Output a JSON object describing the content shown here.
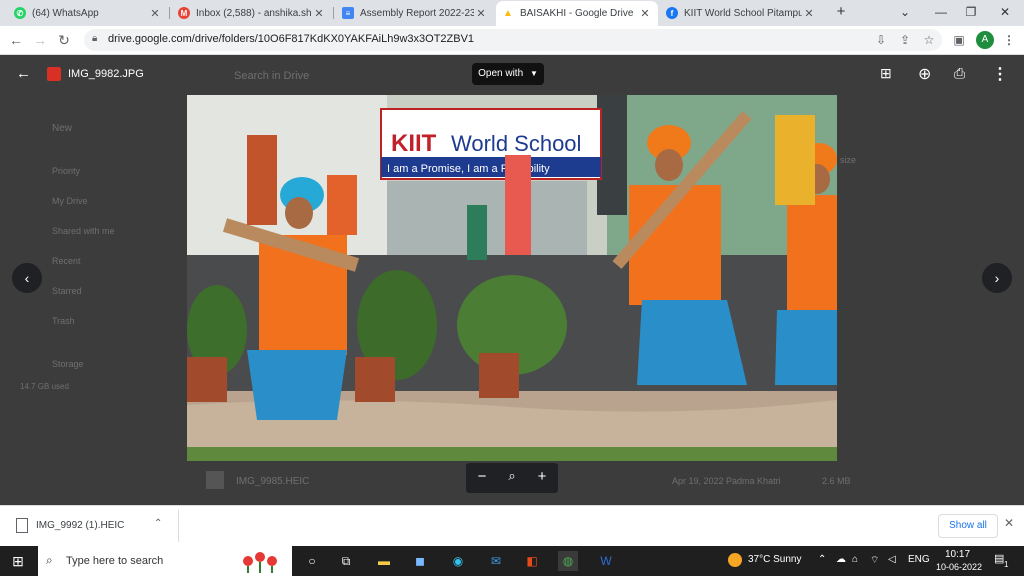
{
  "browser": {
    "tabs": [
      {
        "label": "(64) WhatsApp",
        "color": "#25d366",
        "icon": "whatsapp-icon",
        "glyph": "✆"
      },
      {
        "label": "Inbox (2,588) - anshika.sharm",
        "color": "#ea4335",
        "icon": "gmail-icon",
        "glyph": "M"
      },
      {
        "label": "Assembly Report 2022-23 - G",
        "color": "#4285f4",
        "icon": "docs-icon",
        "glyph": "≡"
      },
      {
        "label": "BAISAKHI - Google Drive",
        "color": "#fbbc04",
        "icon": "drive-icon",
        "glyph": "▲"
      },
      {
        "label": "KIIT World School Pitampura",
        "color": "#1877f2",
        "icon": "facebook-icon",
        "glyph": "f"
      }
    ],
    "new_tab": "+",
    "url": "drive.google.com/drive/folders/10O6F817KdKX0YAKFAiLh9w3x3OT2ZBV1",
    "avatar_letter": "A"
  },
  "viewer": {
    "filename": "IMG_9982.JPG",
    "open_with": "Open with",
    "bg_texts": {
      "search": "Search in Drive",
      "new": "New",
      "priority": "Priority",
      "my_drive": "My Drive",
      "shared": "Shared with me",
      "recent": "Recent",
      "starred": "Starred",
      "trash": "Trash",
      "storage": "Storage",
      "storage_used": "14.7 GB used",
      "size_header": "size",
      "file_row_name": "IMG_9985.HEIC",
      "file_row_date": "Apr 19, 2022 Padma Khatri",
      "file_row_size": "2.6 MB"
    },
    "banner_text": "KIIT World School",
    "banner_sub": "I am a Promise, I am a Possibility"
  },
  "downloads": {
    "item": "IMG_9992 (1).HEIC",
    "show_all": "Show all"
  },
  "taskbar": {
    "search_placeholder": "Type here to search",
    "weather": "37°C  Sunny",
    "lang": "ENG",
    "time": "10:17",
    "date": "10-06-2022",
    "notif_count": "1"
  }
}
